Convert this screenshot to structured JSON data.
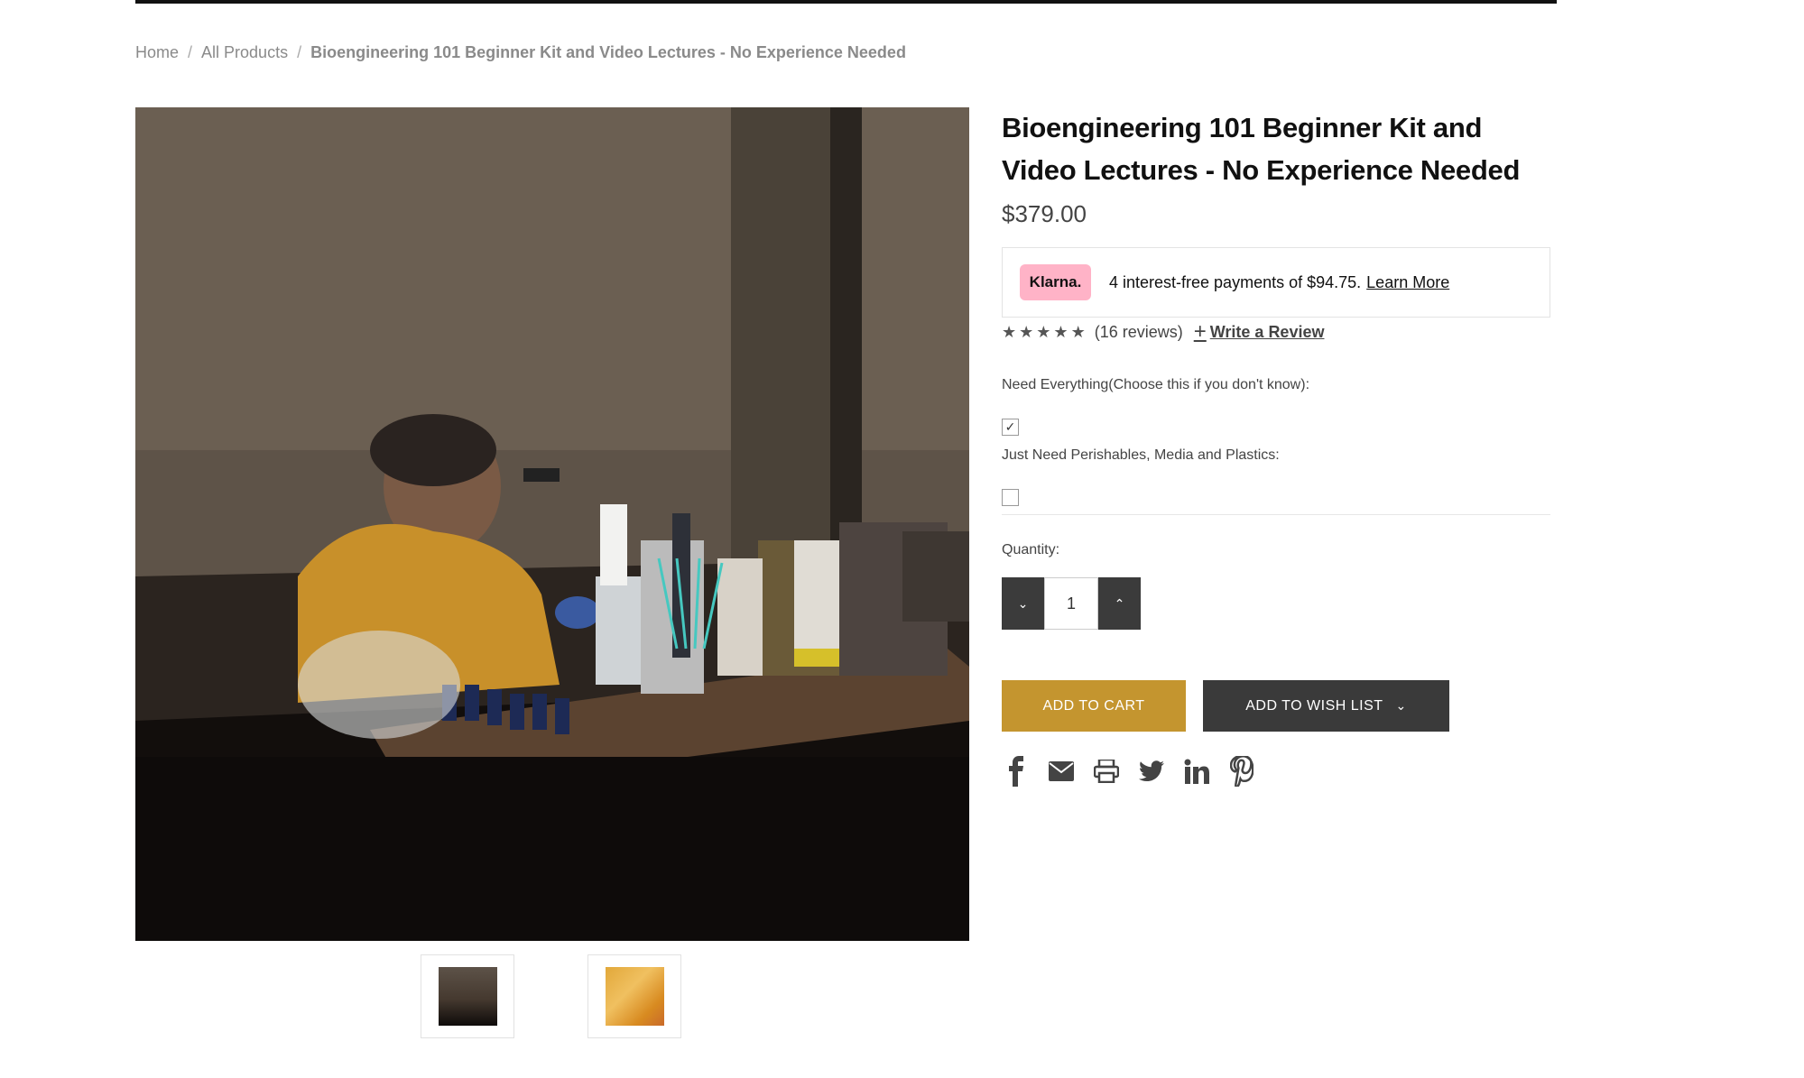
{
  "breadcrumb": {
    "home": "Home",
    "all_products": "All Products",
    "current": "Bioengineering 101 Beginner Kit and Video Lectures - No Experience Needed",
    "separator": "/"
  },
  "product": {
    "title": "Bioengineering 101 Beginner Kit and Video Lectures - No Experience Needed",
    "price": "$379.00"
  },
  "klarna": {
    "badge": "Klarna.",
    "text": "4 interest-free payments of $94.75.",
    "link": "Learn More"
  },
  "rating": {
    "stars": 5,
    "reviews_text": "(16 reviews)",
    "write_review": "Write a Review"
  },
  "options": [
    {
      "label": "Need Everything(Choose this if you don't know):",
      "checked": true
    },
    {
      "label": "Just Need Perishables, Media and Plastics:",
      "checked": false
    }
  ],
  "quantity": {
    "label": "Quantity:",
    "value": "1"
  },
  "buttons": {
    "add_to_cart": "ADD TO CART",
    "add_to_wish_list": "ADD TO WISH LIST"
  },
  "social_icons": [
    "facebook-icon",
    "email-icon",
    "print-icon",
    "twitter-icon",
    "linkedin-icon",
    "pinterest-icon"
  ],
  "colors": {
    "accent_gold": "#c4952f",
    "dark_button": "#3a3a3a",
    "klarna_pink": "#ffb3c7"
  }
}
